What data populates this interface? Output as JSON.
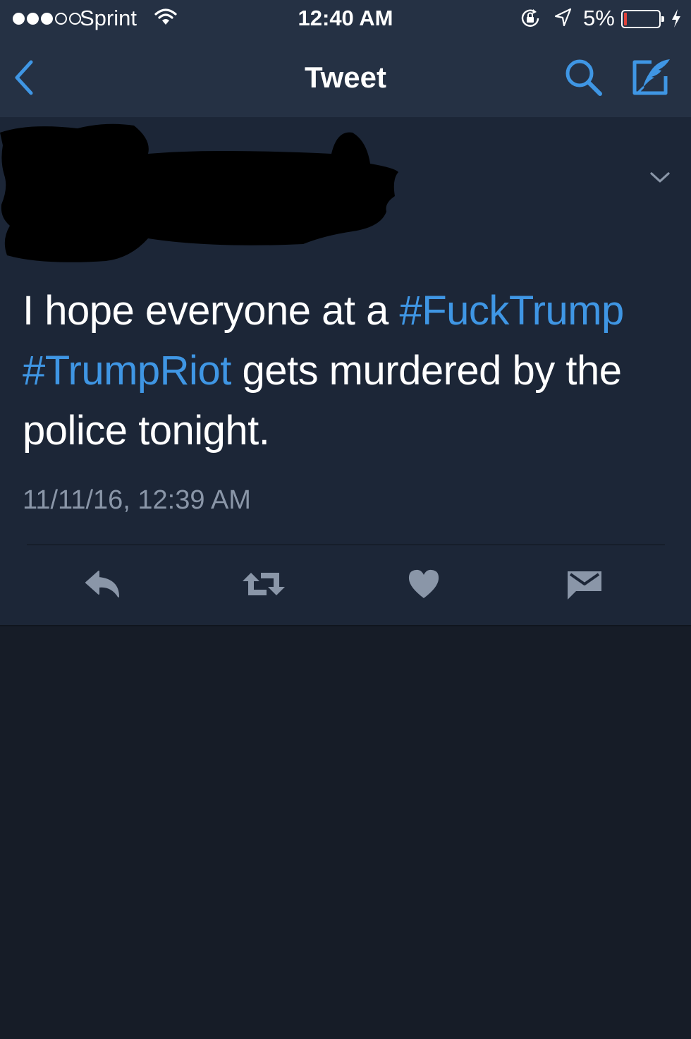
{
  "status_bar": {
    "carrier": "Sprint",
    "time": "12:40 AM",
    "battery_percent": "5%",
    "signal_bars": 3
  },
  "nav": {
    "title": "Tweet",
    "icons": [
      "back-chevron-icon",
      "search-icon",
      "compose-tweet-icon"
    ]
  },
  "tweet": {
    "author": "",
    "text_parts": [
      {
        "text": "I hope everyone at a ",
        "type": "text"
      },
      {
        "text": "#FuckTrump",
        "type": "hashtag"
      },
      {
        "text": " ",
        "type": "text"
      },
      {
        "text": "#TrumpRiot",
        "type": "hashtag"
      },
      {
        "text": " gets murdered by the police tonight.",
        "type": "text"
      }
    ],
    "timestamp": "11/11/16, 12:39 AM",
    "actions": [
      "reply-icon",
      "retweet-icon",
      "like-icon",
      "direct-message-icon"
    ]
  },
  "colors": {
    "header_bg": "#253144",
    "tweet_bg": "#1c2637",
    "page_bg": "#161c27",
    "accent": "#3f96e4",
    "muted": "#8a96a8",
    "battery_low": "#e0423a"
  }
}
